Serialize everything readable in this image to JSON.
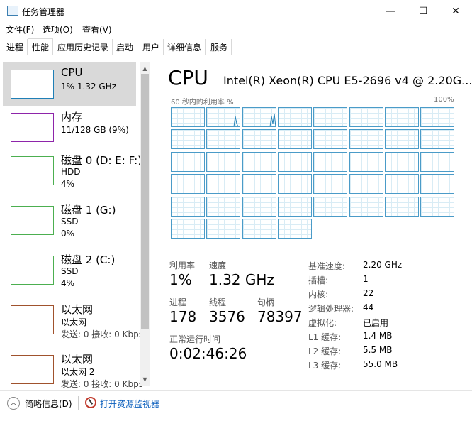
{
  "window": {
    "title": "任务管理器",
    "minimize": "—",
    "maximize": "☐",
    "close": "✕"
  },
  "menu": [
    "文件(F)",
    "选项(O)",
    "查看(V)"
  ],
  "tabs": [
    "进程",
    "性能",
    "应用历史记录",
    "启动",
    "用户",
    "详细信息",
    "服务"
  ],
  "active_tab": "性能",
  "sidebar": {
    "items": [
      {
        "title": "CPU",
        "sub1": "1% 1.32 GHz",
        "sub2": "",
        "color": "#1f7fb6"
      },
      {
        "title": "内存",
        "sub1": "11/128 GB (9%)",
        "sub2": "",
        "color": "#8e24aa"
      },
      {
        "title": "磁盘 0 (D: E: F:)",
        "sub1": "HDD",
        "sub2": "4%",
        "color": "#4caf50"
      },
      {
        "title": "磁盘 1 (G:)",
        "sub1": "SSD",
        "sub2": "0%",
        "color": "#4caf50"
      },
      {
        "title": "磁盘 2 (C:)",
        "sub1": "SSD",
        "sub2": "4%",
        "color": "#4caf50"
      },
      {
        "title": "以太网",
        "sub1": "以太网",
        "sub2": "发送: 0 接收: 0 Kbps",
        "color": "#a0522d"
      },
      {
        "title": "以太网",
        "sub1": "以太网 2",
        "sub2": "发送: 0 接收: 0 Kbps",
        "color": "#a0522d"
      }
    ]
  },
  "main": {
    "title": "CPU",
    "model": "Intel(R) Xeon(R) CPU E5-2696 v4 @ 2.20G...",
    "util_label": "60 秒内的利用率 %",
    "util_max": "100%",
    "logical_cpu_count": 44
  },
  "stats": {
    "util_label": "利用率",
    "util_value": "1%",
    "speed_label": "速度",
    "speed_value": "1.32 GHz",
    "proc_label": "进程",
    "proc_value": "178",
    "thread_label": "线程",
    "thread_value": "3576",
    "handle_label": "句柄",
    "handle_value": "78397",
    "uptime_label": "正常运行时间",
    "uptime_value": "0:02:46:26"
  },
  "info": [
    {
      "label": "基准速度:",
      "value": "2.20 GHz"
    },
    {
      "label": "插槽:",
      "value": "1"
    },
    {
      "label": "内核:",
      "value": "22"
    },
    {
      "label": "逻辑处理器:",
      "value": "44"
    },
    {
      "label": "虚拟化:",
      "value": "已启用"
    },
    {
      "label": "L1 缓存:",
      "value": "1.4 MB"
    },
    {
      "label": "L2 缓存:",
      "value": "5.5 MB"
    },
    {
      "label": "L3 缓存:",
      "value": "55.0 MB"
    }
  ],
  "footer": {
    "brief": "简略信息(D)",
    "monitor": "打开资源监视器"
  }
}
